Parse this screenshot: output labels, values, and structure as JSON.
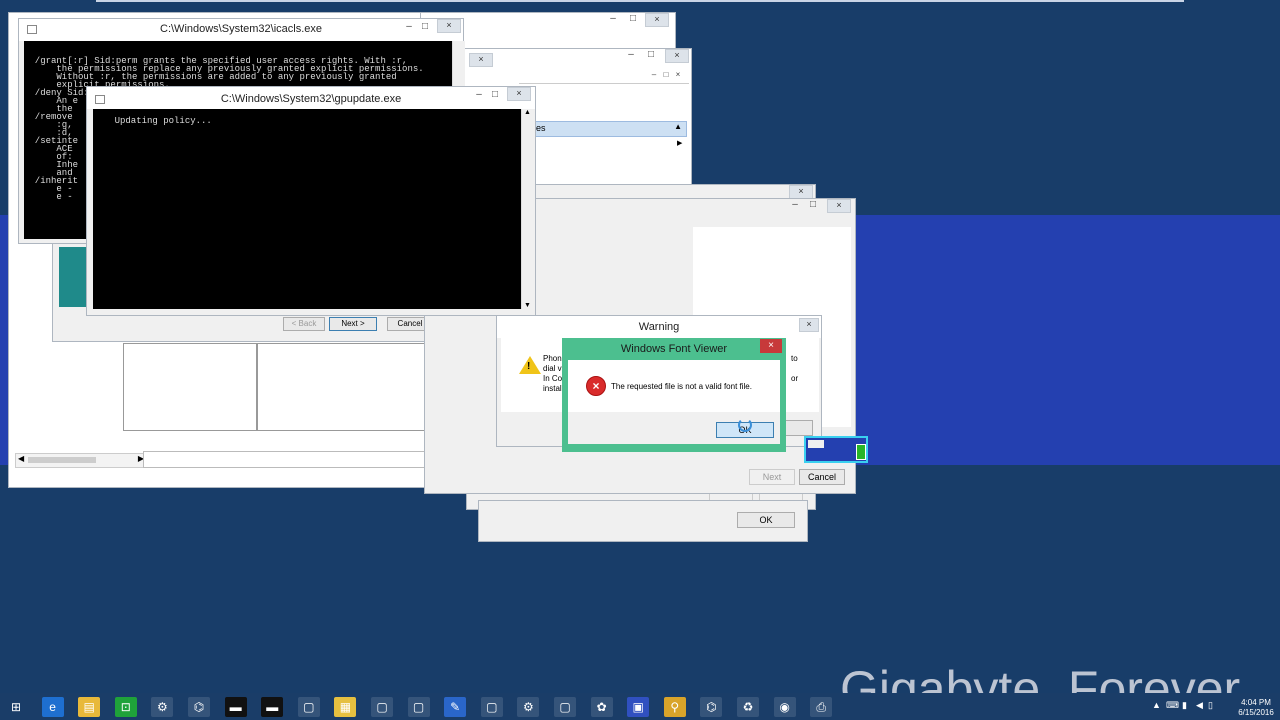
{
  "desktop": {
    "band_color": "#2440b0",
    "background": "#183d69"
  },
  "icacls": {
    "title": "C:\\Windows\\System32\\icacls.exe",
    "lines": [
      "  /grant[:r] Sid:perm grants the specified user access rights. With :r,",
      "      the permissions replace any previously granted explicit permissions.",
      "      Without :r, the permissions are added to any previously granted",
      "      explicit permissions.",
      "",
      "  /deny Sid:perm explicitly denies the specified user access rights.",
      "      An e",
      "      the",
      "",
      "  /remove",
      "      :g,",
      "      :d,",
      "",
      "  /setinte",
      "      ACE",
      "      of:",
      "",
      "",
      "      Inhe",
      "      and",
      "",
      "  /inherit",
      "      e -",
      "      e -"
    ]
  },
  "gpupdate": {
    "title": "C:\\Windows\\System32\\gpupdate.exe",
    "text": "Updating policy..."
  },
  "wizard_buttons": {
    "back": "< Back",
    "next": "Next >",
    "cancel": "Cancel"
  },
  "mmc": {
    "selected_item": "es"
  },
  "warning": {
    "title": "Warning",
    "text_lines": [
      "Phon",
      "dial v",
      "In Co",
      "instal"
    ],
    "right_fragments": [
      "to",
      "or"
    ],
    "button_fragment": "k"
  },
  "font_viewer": {
    "title": "Windows Font Viewer",
    "message": "The requested file  is not a valid font file.",
    "ok_label": "OK"
  },
  "setup_dialog": {
    "next": "Next",
    "cancel": "Cancel"
  },
  "ok_dialog": {
    "ok": "OK"
  },
  "window_controls": {
    "minimize": "–",
    "maximize": "□",
    "close": "×"
  },
  "clock": {
    "time": "4:04 PM",
    "date": "6/15/2016"
  },
  "watermark": "Gigabyte_Forever",
  "taskbar": {
    "start_icon": "windows-logo-icon",
    "items": [
      "internet-explorer-icon",
      "file-explorer-icon",
      "store-icon",
      "control-panel-icon",
      "network-icon",
      "cmd-icon",
      "cmd-icon",
      "window-icon",
      "calculator-icon",
      "window-icon",
      "window-icon",
      "paint-icon",
      "window-icon",
      "settings-icon",
      "window-icon",
      "colors-icon",
      "display-icon",
      "search-icon",
      "network-icon",
      "recycle-icon",
      "media-icon",
      "printer-icon"
    ]
  }
}
